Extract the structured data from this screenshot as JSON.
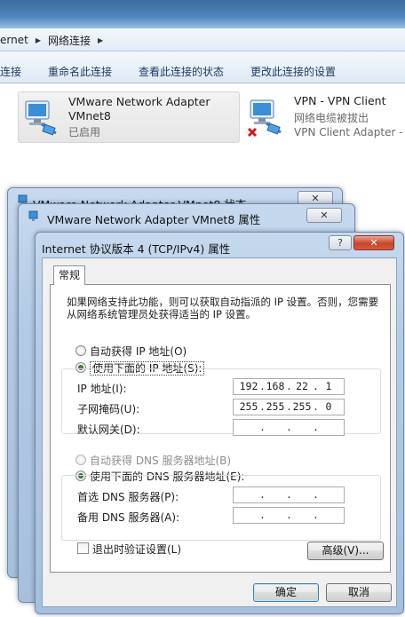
{
  "explorer": {
    "breadcrumb": [
      "ernet",
      "网络连接"
    ],
    "commands": [
      "连接",
      "重命名此连接",
      "查看此连接的状态",
      "更改此连接的设置"
    ],
    "adapters": [
      {
        "name": "VMware Network Adapter",
        "name2": "VMnet8",
        "status": "已启用",
        "selected": true
      },
      {
        "name": "VPN - VPN Client",
        "status": "网络电缆被拔出",
        "device": "VPN Client Adapter -",
        "selected": false
      }
    ]
  },
  "dialogs": {
    "status_title": "VMware Network Adapter VMnet8 状态",
    "props_title": "VMware Network Adapter VMnet8 属性",
    "close_glyph": "✕",
    "ipv4": {
      "title": "Internet 协议版本 4 (TCP/IPv4) 属性",
      "help_glyph": "?",
      "tab": "常规",
      "description": "如果网络支持此功能，则可以获取自动指派的 IP 设置。否则，您需要从网络系统管理员处获得适当的 IP 设置。",
      "ip_section": {
        "auto_label": "自动获得 IP 地址(O)",
        "manual_label": "使用下面的 IP 地址(S):",
        "selected": "manual",
        "fields": [
          {
            "label": "IP 地址(I):",
            "value": [
              "192",
              "168",
              "22",
              "1"
            ]
          },
          {
            "label": "子网掩码(U):",
            "value": [
              "255",
              "255",
              "255",
              "0"
            ]
          },
          {
            "label": "默认网关(D):",
            "value": [
              "",
              "",
              "",
              ""
            ]
          }
        ]
      },
      "dns_section": {
        "auto_label": "自动获得 DNS 服务器地址(B)",
        "manual_label": "使用下面的 DNS 服务器地址(E):",
        "selected": "manual",
        "fields": [
          {
            "label": "首选 DNS 服务器(P):",
            "value": [
              "",
              "",
              "",
              ""
            ]
          },
          {
            "label": "备用 DNS 服务器(A):",
            "value": [
              "",
              "",
              "",
              ""
            ]
          }
        ]
      },
      "validate_on_exit": {
        "label": "退出时验证设置(L)",
        "checked": false
      },
      "advanced_button": "高级(V)...",
      "ok_button": "确定",
      "cancel_button": "取消"
    }
  },
  "colors": {
    "accent": "#3c7fb1",
    "titlebar": "#4f86bf",
    "error_red": "#d4191a"
  }
}
